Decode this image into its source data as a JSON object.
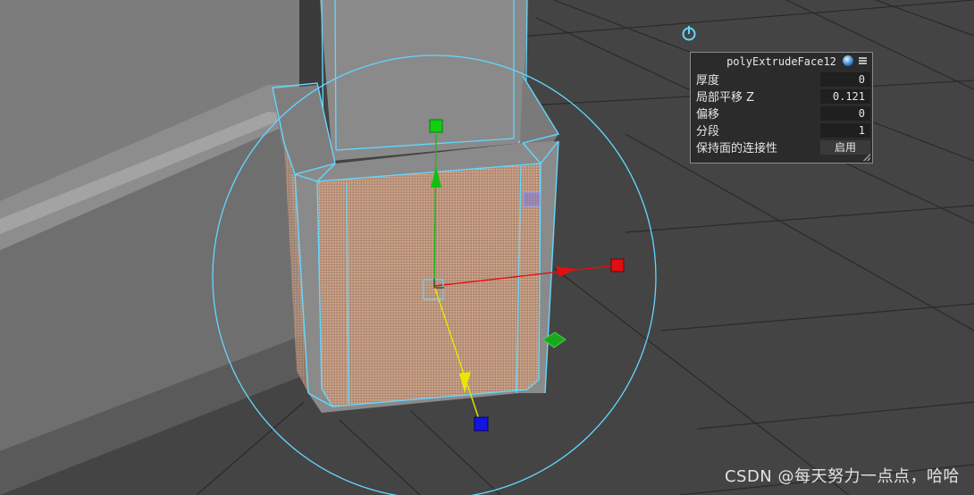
{
  "hud": {
    "title": "polyExtrudeFace12",
    "rows": [
      {
        "label": "厚度",
        "value": "0"
      },
      {
        "label": "局部平移 Z",
        "value": "0.121"
      },
      {
        "label": "偏移",
        "value": "0"
      },
      {
        "label": "分段",
        "value": "1"
      },
      {
        "label": "保持面的连接性",
        "value": "启用"
      }
    ]
  },
  "watermark": "CSDN @每天努力一点点，哈哈",
  "colors": {
    "viewport_bg": "#444444",
    "grid": "#2a2a2a",
    "selection_wire": "#63d7ff",
    "axis_x": "#e01010",
    "axis_y": "#10c010",
    "axis_z": "#1010e0",
    "axis_arrow_down": "#e8e800",
    "selected_face": "#d4a98a"
  },
  "icons": {
    "pivot": "power-icon",
    "hud_toggle": "sphere-icon",
    "hud_menu": "menu-icon"
  }
}
